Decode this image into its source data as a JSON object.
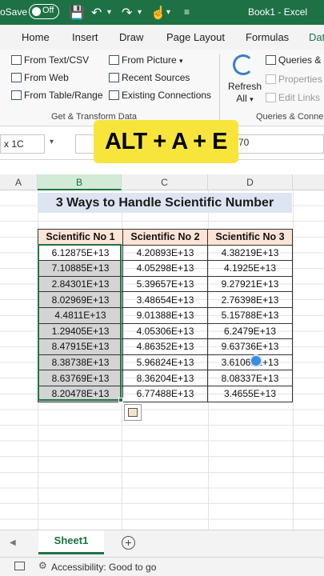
{
  "titlebar": {
    "autosave_label": "oSave",
    "toggle_state": "Off",
    "document_title": "Book1  -  Excel"
  },
  "tabs": [
    "Home",
    "Insert",
    "Draw",
    "Page Layout",
    "Formulas",
    "Dat"
  ],
  "ribbon": {
    "get_transform": {
      "items": [
        "From Text/CSV",
        "From Web",
        "From Table/Range",
        "From Picture",
        "Recent Sources",
        "Existing Connections"
      ],
      "label": "Get & Transform Data"
    },
    "queries": {
      "refresh_line1": "Refresh",
      "refresh_line2": "All",
      "items": [
        "Queries & C",
        "Properties",
        "Edit Links"
      ],
      "label": "Queries & Conne"
    }
  },
  "formula_bar": {
    "name_box": "x 1C",
    "value": "70"
  },
  "overlay_text": "ALT + A + E",
  "grid": {
    "columns": [
      "A",
      "B",
      "C",
      "D"
    ],
    "title": "3 Ways to Handle Scientific Number",
    "headers": [
      "Scientific No 1",
      "Scientific No 2",
      "Scientific No 3"
    ],
    "rows": [
      [
        "6.12875E+13",
        "4.20893E+13",
        "4.38219E+13"
      ],
      [
        "7.10885E+13",
        "4.05298E+13",
        "4.1925E+13"
      ],
      [
        "2.84301E+13",
        "5.39657E+13",
        "9.27921E+13"
      ],
      [
        "8.02969E+13",
        "3.48654E+13",
        "2.76398E+13"
      ],
      [
        "4.4811E+13",
        "9.01388E+13",
        "5.15788E+13"
      ],
      [
        "1.29405E+13",
        "4.05306E+13",
        "6.2479E+13"
      ],
      [
        "8.47915E+13",
        "4.86352E+13",
        "9.63736E+13"
      ],
      [
        "8.38738E+13",
        "5.96824E+13",
        "3.61062E+13"
      ],
      [
        "8.63769E+13",
        "8.36204E+13",
        "8.08337E+13"
      ],
      [
        "8.20478E+13",
        "6.77488E+13",
        "3.4655E+13"
      ]
    ]
  },
  "sheet_tabs": {
    "active": "Sheet1",
    "add_label": "+"
  },
  "status": {
    "accessibility": "Accessibility: Good to go"
  },
  "colors": {
    "excel_green": "#1e7145",
    "overlay_yellow": "#f7e53c",
    "title_fill": "#dde5f2",
    "header_fill": "#fce4d6",
    "selection_fill": "#d4d4d4"
  }
}
